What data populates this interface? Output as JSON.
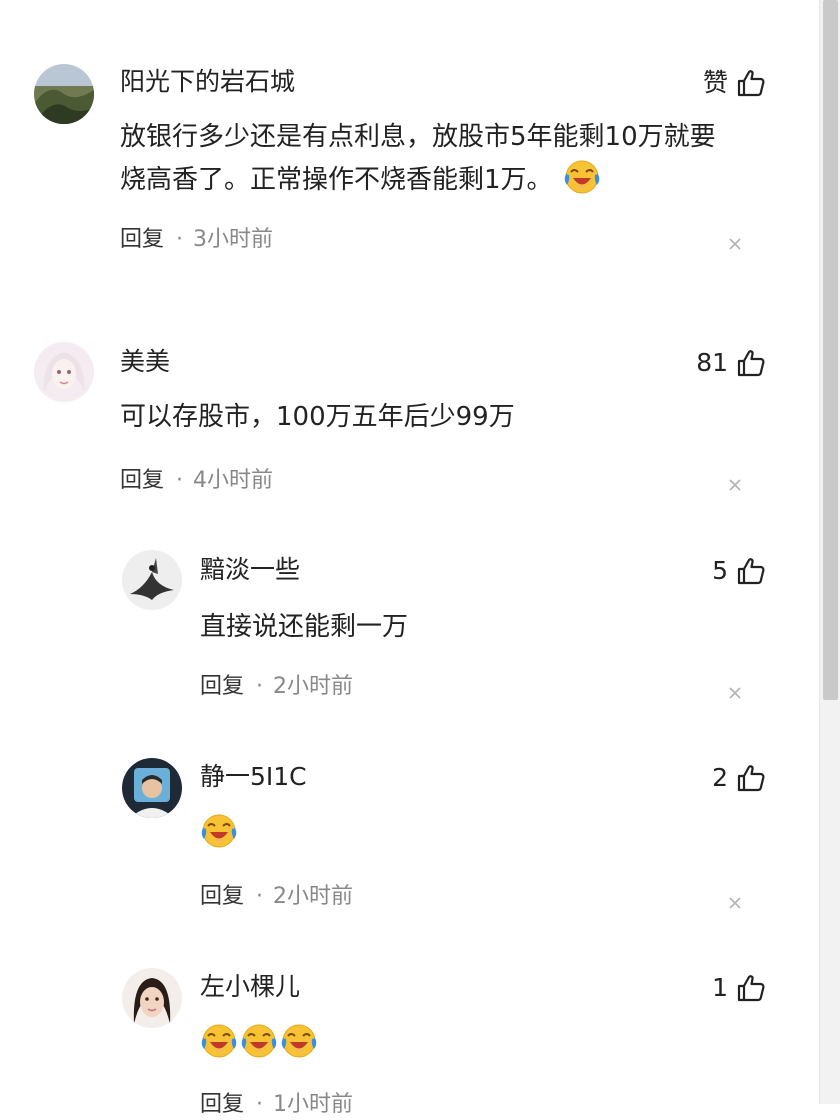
{
  "reply_label": "回复",
  "separator": "·",
  "comments": [
    {
      "name": "阳光下的岩石城",
      "likes": "赞",
      "content": [
        "放银行多少还是有点利息，放股市5年能剩10万就要",
        "烧高香了。正常操作不烧香能剩1万。"
      ],
      "time": "3小时前"
    },
    {
      "name": "美美",
      "likes": "81",
      "content": [
        "可以存股市，100万五年后少99万"
      ],
      "time": "4小时前"
    },
    {
      "name": "黯淡一些",
      "likes": "5",
      "content": [
        "直接说还能剩一万"
      ],
      "time": "2小时前"
    },
    {
      "name": "静一5I1C",
      "likes": "2",
      "content": [],
      "time": "2小时前"
    },
    {
      "name": "左小棵儿",
      "likes": "1",
      "content": [],
      "time": "1小时前"
    }
  ],
  "icons": {
    "like": "thumbs-up-icon",
    "emoji": "laughing-crying-emoji-icon",
    "close": "close-icon"
  },
  "colors": {
    "text": "#222222",
    "muted": "#888888",
    "emoji_face": "#f7c233"
  }
}
